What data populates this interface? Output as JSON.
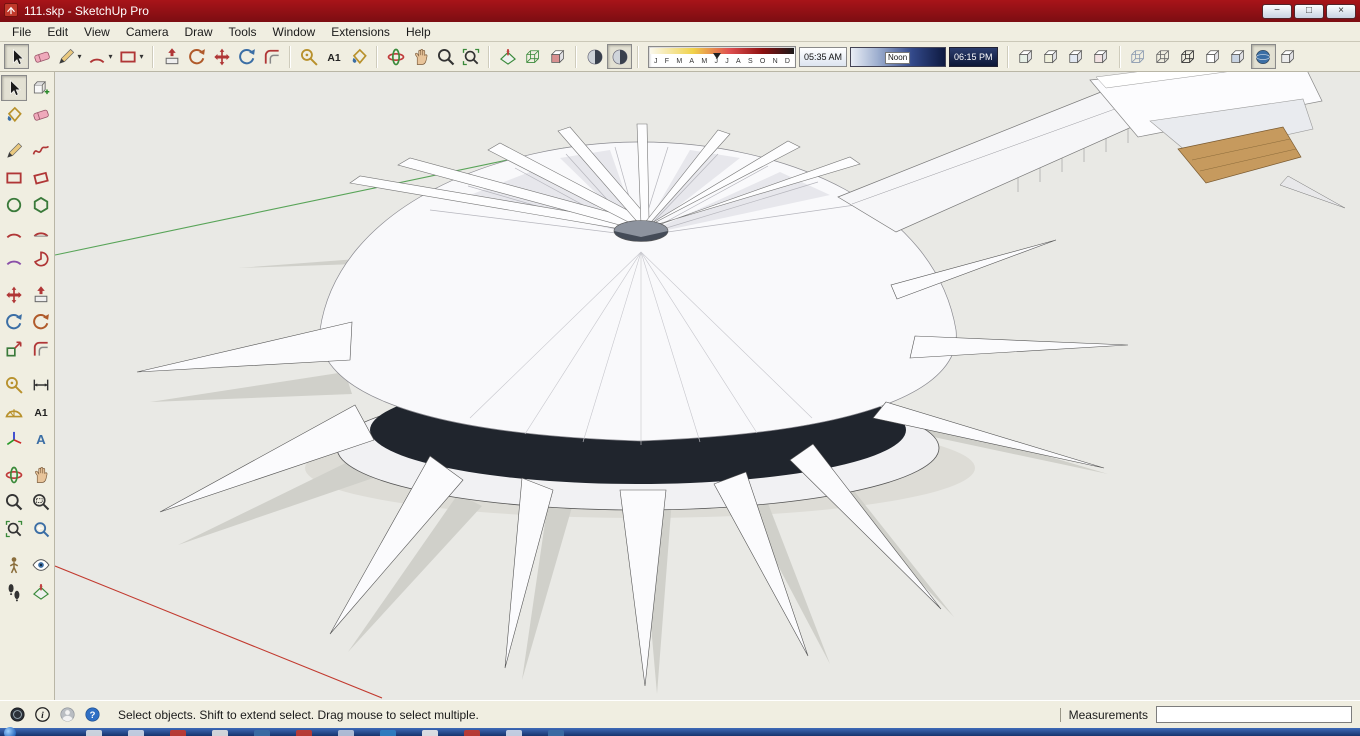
{
  "window": {
    "title": "111.skp - SketchUp Pro",
    "controls": [
      {
        "name": "minimize-button",
        "glyph": "−"
      },
      {
        "name": "maximize-button",
        "glyph": "□"
      },
      {
        "name": "close-button",
        "glyph": "×"
      }
    ]
  },
  "menu": {
    "items": [
      "File",
      "Edit",
      "View",
      "Camera",
      "Draw",
      "Tools",
      "Window",
      "Extensions",
      "Help"
    ]
  },
  "toolbar": {
    "dropdown_glyph": "▾",
    "groups": [
      {
        "name": "principal",
        "icons": [
          {
            "name": "select-tool",
            "shape": "cursor",
            "color": "#1b1b1b",
            "pressed": true
          },
          {
            "name": "eraser-tool",
            "shape": "eraser",
            "color": "#efa9bb"
          },
          {
            "name": "line-tool",
            "shape": "pencil",
            "color": "#e9c87e",
            "dropdown": true
          },
          {
            "name": "arc-tools",
            "shape": "arc",
            "color": "#b03636",
            "dropdown": true
          },
          {
            "name": "shape-tools",
            "shape": "rect",
            "color": "#b03636",
            "dropdown": true
          }
        ]
      },
      {
        "name": "edit",
        "icons": [
          {
            "name": "push-pull-tool",
            "shape": "pushpull",
            "color": "#b03636"
          },
          {
            "name": "follow-me-tool",
            "shape": "rotate",
            "color": "#b05a2a"
          },
          {
            "name": "move-tool",
            "shape": "move",
            "color": "#b03636"
          },
          {
            "name": "rotate-tool",
            "shape": "rotate",
            "color": "#3b6ea5"
          },
          {
            "name": "offset-tool",
            "shape": "offset",
            "color": "#b03636"
          }
        ]
      },
      {
        "name": "construction",
        "icons": [
          {
            "name": "tape-measure-tool",
            "shape": "tape",
            "color": "#b8912c"
          },
          {
            "name": "text-tool",
            "shape": "textA1",
            "color": "#222222"
          },
          {
            "name": "paint-bucket-tool",
            "shape": "bucket",
            "color": "#b8912c"
          }
        ]
      },
      {
        "name": "camera",
        "icons": [
          {
            "name": "orbit-tool",
            "shape": "orbit",
            "color": "#c03a3a"
          },
          {
            "name": "pan-tool",
            "shape": "pan",
            "color": "#e8c49a"
          },
          {
            "name": "zoom-tool",
            "shape": "zoom",
            "color": "#333333"
          },
          {
            "name": "zoom-extents-tool",
            "shape": "zoomext",
            "color": "#333333"
          }
        ]
      },
      {
        "name": "section",
        "icons": [
          {
            "name": "section-plane-tool",
            "shape": "section",
            "color": "#3a8a3a"
          },
          {
            "name": "display-section-planes-toggle",
            "shape": "cubewire",
            "color": "#3a8a3a"
          },
          {
            "name": "display-section-cuts-toggle",
            "shape": "cube",
            "color": "#d89090"
          }
        ]
      },
      {
        "name": "shadow-toggles",
        "icons": [
          {
            "name": "shadow-settings-dialog",
            "shape": "shadowball",
            "color": "#39404d"
          },
          {
            "name": "shadows-toggle",
            "shape": "shadowball",
            "color": "#39404d",
            "pressed": true
          }
        ]
      },
      {
        "name": "shadow-settings-strip",
        "kind": "shadows"
      },
      {
        "name": "views",
        "icons": [
          {
            "name": "iso-view",
            "shape": "cube",
            "color": "#e6efe6"
          },
          {
            "name": "top-view",
            "shape": "cube",
            "color": "#f0f0dc"
          },
          {
            "name": "front-view",
            "shape": "cube",
            "color": "#e2e8f2"
          },
          {
            "name": "right-view",
            "shape": "cube",
            "color": "#f2e2e2"
          }
        ]
      },
      {
        "name": "styles",
        "icons": [
          {
            "name": "style-x-ray",
            "shape": "cubewire",
            "color": "#8a9ab0"
          },
          {
            "name": "style-back-edges",
            "shape": "cubewire",
            "color": "#666666"
          },
          {
            "name": "style-wireframe",
            "shape": "cubewire",
            "color": "#2f2f2f"
          },
          {
            "name": "style-hidden-line",
            "shape": "cube",
            "color": "#ffffff"
          },
          {
            "name": "style-shaded",
            "shape": "cube",
            "color": "#c9d4e2"
          },
          {
            "name": "style-shaded-with-textures",
            "shape": "sphere",
            "color": "#3b6ea5",
            "pressed": true
          },
          {
            "name": "style-monochrome",
            "shape": "cube",
            "color": "#ececec"
          }
        ]
      }
    ],
    "shadows": {
      "months": [
        "J",
        "F",
        "M",
        "A",
        "M",
        "J",
        "J",
        "A",
        "S",
        "O",
        "N",
        "D"
      ],
      "start_time": "05:35 AM",
      "noon_label": "Noon",
      "end_time": "06:15 PM"
    }
  },
  "palette": {
    "gaps_after": [
      3,
      13,
      19,
      25,
      31
    ],
    "tools": [
      {
        "name": "select-tool",
        "shape": "cursor",
        "color": "#1b1b1b",
        "pressed": true
      },
      {
        "name": "make-component-tool",
        "shape": "component",
        "color": "#666666"
      },
      {
        "name": "paint-bucket-tool",
        "shape": "bucket",
        "color": "#b8912c"
      },
      {
        "name": "eraser-tool",
        "shape": "eraser",
        "color": "#efa9bb"
      },
      {
        "name": "line-tool",
        "shape": "pencil",
        "color": "#e9c87e"
      },
      {
        "name": "freehand-tool",
        "shape": "squiggle",
        "color": "#b03636"
      },
      {
        "name": "rectangle-tool",
        "shape": "rect",
        "color": "#b03636"
      },
      {
        "name": "rotated-rectangle-tool",
        "shape": "rotrect",
        "color": "#b03636"
      },
      {
        "name": "circle-tool",
        "shape": "circle",
        "color": "#3a7a3a"
      },
      {
        "name": "polygon-tool",
        "shape": "polygon",
        "color": "#3a7a3a"
      },
      {
        "name": "arc-tool",
        "shape": "arc",
        "color": "#b03636"
      },
      {
        "name": "two-point-arc-tool",
        "shape": "arc2",
        "color": "#b03636"
      },
      {
        "name": "three-point-arc-tool",
        "shape": "arc",
        "color": "#8a4fa8"
      },
      {
        "name": "pie-tool",
        "shape": "pie",
        "color": "#b03636"
      },
      {
        "name": "move-tool",
        "shape": "move",
        "color": "#b03636"
      },
      {
        "name": "push-pull-tool",
        "shape": "pushpull",
        "color": "#b03636"
      },
      {
        "name": "rotate-tool",
        "shape": "rotate",
        "color": "#3b6ea5"
      },
      {
        "name": "follow-me-tool",
        "shape": "rotate",
        "color": "#b05a2a"
      },
      {
        "name": "scale-tool",
        "shape": "scale",
        "color": "#b03636"
      },
      {
        "name": "offset-tool",
        "shape": "offset",
        "color": "#b03636"
      },
      {
        "name": "tape-measure-tool",
        "shape": "tape",
        "color": "#b8912c"
      },
      {
        "name": "dimension-tool",
        "shape": "dimension",
        "color": "#333333"
      },
      {
        "name": "protractor-tool",
        "shape": "protractor",
        "color": "#b8912c"
      },
      {
        "name": "text-tool",
        "shape": "textA1",
        "color": "#222222"
      },
      {
        "name": "axes-tool",
        "shape": "axes",
        "color": "#333333"
      },
      {
        "name": "3d-text-tool",
        "shape": "text3d",
        "color": "#3b6ea5"
      },
      {
        "name": "orbit-tool",
        "shape": "orbit",
        "color": "#c03a3a"
      },
      {
        "name": "pan-tool",
        "shape": "pan",
        "color": "#e8c49a"
      },
      {
        "name": "zoom-tool",
        "shape": "zoom",
        "color": "#333333"
      },
      {
        "name": "zoom-window-tool",
        "shape": "zoomwin",
        "color": "#333333"
      },
      {
        "name": "zoom-extents-tool",
        "shape": "zoomext",
        "color": "#333333"
      },
      {
        "name": "previous-view-tool",
        "shape": "prev",
        "color": "#3b6ea5"
      },
      {
        "name": "position-camera-tool",
        "shape": "person",
        "color": "#8a6d3b"
      },
      {
        "name": "look-around-tool",
        "shape": "eye",
        "color": "#3b6ea5"
      },
      {
        "name": "walk-tool",
        "shape": "walk",
        "color": "#333333"
      },
      {
        "name": "section-plane-tool",
        "shape": "section",
        "color": "#3a8a3a"
      }
    ]
  },
  "statusbar": {
    "icons": [
      {
        "name": "geo-location-icon",
        "shape": "globe"
      },
      {
        "name": "credits-icon",
        "shape": "info"
      },
      {
        "name": "sign-in-icon",
        "shape": "avatar"
      },
      {
        "name": "help-icon",
        "shape": "help"
      }
    ],
    "message": "Select objects. Shift to extend select. Drag mouse to select multiple.",
    "measurements_label": "Measurements",
    "measurements_value": ""
  },
  "taskbar": {
    "fragments": [
      "#d8dde4",
      "#cdd6e6",
      "#c23a2f",
      "#e0e0e0",
      "#3b6ea5",
      "#c23a2f",
      "#b8c4da",
      "#2f7fc2",
      "#e8e8e8",
      "#c23a2f",
      "#cfd8e8",
      "#3b6ea5"
    ]
  },
  "colors": {
    "titlebar": "#8e1016",
    "chrome": "#f0eee1",
    "viewport_bg": "#e9e9e5",
    "axis_green": "#58a458",
    "axis_red": "#c23a2f",
    "glass_band": "#20252d"
  }
}
